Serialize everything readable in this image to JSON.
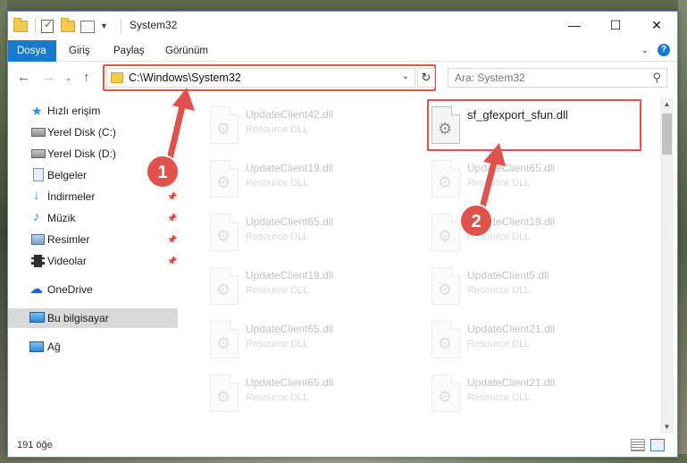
{
  "window": {
    "title": "System32",
    "controls": [
      "—",
      "☐",
      "✕"
    ]
  },
  "ribbon": {
    "tabs": [
      "Dosya",
      "Giriş",
      "Paylaş",
      "Görünüm"
    ],
    "active_tab": "Dosya",
    "help_label": "?"
  },
  "nav": {
    "address": "C:\\Windows\\System32",
    "search_placeholder": "Ara: System32"
  },
  "sidebar": {
    "items": [
      {
        "label": "Hızlı erişim",
        "icon": "star-icon"
      },
      {
        "label": "Yerel Disk (C:)",
        "icon": "drive-icon"
      },
      {
        "label": "Yerel Disk (D:)",
        "icon": "drive-icon"
      },
      {
        "label": "Belgeler",
        "icon": "document-icon"
      },
      {
        "label": "İndirmeler",
        "icon": "download-icon",
        "pinned": true
      },
      {
        "label": "Müzik",
        "icon": "music-icon",
        "pinned": true
      },
      {
        "label": "Resimler",
        "icon": "pictures-icon",
        "pinned": true
      },
      {
        "label": "Videolar",
        "icon": "video-icon",
        "pinned": true
      },
      {
        "label": "OneDrive",
        "icon": "cloud-icon"
      },
      {
        "label": "Bu bilgisayar",
        "icon": "computer-icon",
        "selected": true
      },
      {
        "label": "Ağ",
        "icon": "network-icon"
      }
    ]
  },
  "files": {
    "left_column": [
      {
        "name": "UpdateClient42.dll",
        "type": "Resource DLL"
      },
      {
        "name": "UpdateClient19.dll",
        "type": "Resource DLL"
      },
      {
        "name": "UpdateClient65.dll",
        "type": "Resource DLL"
      },
      {
        "name": "UpdateClient19.dll",
        "type": "Resource DLL"
      },
      {
        "name": "UpdateClient65.dll",
        "type": "Resource DLL"
      },
      {
        "name": "UpdateClient65.dll",
        "type": "Resource DLL"
      }
    ],
    "right_column": [
      {
        "name": "sf_gfexport_sfun.dll",
        "type": ""
      },
      {
        "name": "UpdateClient65.dll",
        "type": "Resource DLL"
      },
      {
        "name": "UpdateClient19.dll",
        "type": "Resource DLL"
      },
      {
        "name": "UpdateClient5.dll",
        "type": "Resource DLL"
      },
      {
        "name": "UpdateClient21.dll",
        "type": "Resource DLL"
      },
      {
        "name": "UpdateClient21.dll",
        "type": "Resource DLL"
      }
    ]
  },
  "status": {
    "item_count": "191 öğe"
  },
  "annotations": {
    "badge_1": "1",
    "badge_2": "2",
    "color": "#e0524c"
  }
}
